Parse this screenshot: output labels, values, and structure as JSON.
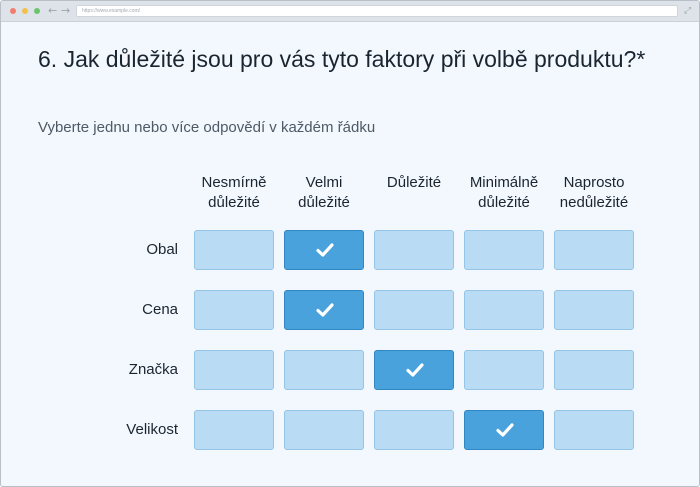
{
  "browser": {
    "url": "https://www.example.com/"
  },
  "question": {
    "title": "6. Jak důležité jsou pro vás tyto faktory při volbě produktu?*",
    "subtitle": "Vyberte jednu nebo více odpovědí v každém řádku"
  },
  "matrix": {
    "columns": [
      {
        "label": "Nesmírně důležité"
      },
      {
        "label": "Velmi důležité"
      },
      {
        "label": "Důležité"
      },
      {
        "label": "Minimálně důležité"
      },
      {
        "label": "Naprosto nedůležité"
      }
    ],
    "rows": [
      {
        "label": "Obal",
        "selected": [
          false,
          true,
          false,
          false,
          false
        ]
      },
      {
        "label": "Cena",
        "selected": [
          false,
          true,
          false,
          false,
          false
        ]
      },
      {
        "label": "Značka",
        "selected": [
          false,
          false,
          true,
          false,
          false
        ]
      },
      {
        "label": "Velikost",
        "selected": [
          false,
          false,
          false,
          true,
          false
        ]
      }
    ]
  },
  "colors": {
    "cell_unchecked": "#b9dcf4",
    "cell_checked": "#49a2dc",
    "page_background": "#f2f8fe"
  },
  "icons": {
    "check": "check-icon"
  }
}
